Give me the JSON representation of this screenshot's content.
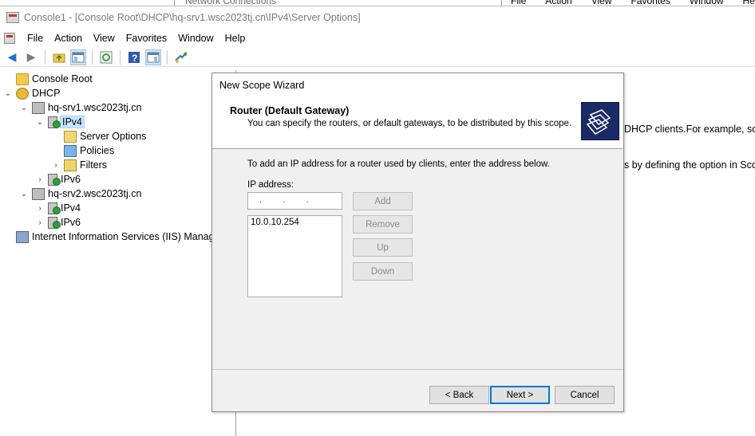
{
  "behind": {
    "title": "Network Connections",
    "menu": [
      "File",
      "Action",
      "View",
      "Favorites",
      "Window",
      "Help"
    ]
  },
  "window": {
    "title": "Console1 - [Console Root\\DHCP\\hq-srv1.wsc2023tj.cn\\IPv4\\Server Options]"
  },
  "menubar": {
    "items": [
      "File",
      "Action",
      "View",
      "Favorites",
      "Window",
      "Help"
    ]
  },
  "toolbar": {
    "icons": [
      "back-icon",
      "forward-icon",
      "up-folder-icon",
      "show-hide-tree-icon",
      "refresh-icon",
      "help-icon",
      "action-pane-icon",
      "dhcp-tool-icon"
    ]
  },
  "tree": {
    "items": [
      {
        "label": "Console Root",
        "icon": "folder-icon"
      },
      {
        "label": "DHCP",
        "icon": "dhcp-icon"
      },
      {
        "label": "hq-srv1.wsc2023tj.cn",
        "icon": "server-icon"
      },
      {
        "label": "IPv4",
        "icon": "ipv4-icon",
        "selected": true
      },
      {
        "label": "Server Options",
        "icon": "server-options-icon"
      },
      {
        "label": "Policies",
        "icon": "policies-icon"
      },
      {
        "label": "Filters",
        "icon": "filters-icon"
      },
      {
        "label": "IPv6",
        "icon": "ipv6-icon"
      },
      {
        "label": "hq-srv2.wsc2023tj.cn",
        "icon": "server-icon"
      },
      {
        "label": "IPv4",
        "icon": "ipv4-icon"
      },
      {
        "label": "IPv6",
        "icon": "ipv6-icon"
      },
      {
        "label": "Internet Information Services (IIS) Manage",
        "icon": "iis-icon"
      }
    ]
  },
  "right_pane": {
    "text1": "DHCP clients.For example, som",
    "text2": "s by defining the option in Scop"
  },
  "wizard": {
    "title": "New Scope Wizard",
    "header_title": "Router (Default Gateway)",
    "header_subtitle": "You can specify the routers, or default gateways, to be distributed by this scope.",
    "instruction": "To add an IP address for a router used by clients, enter the address below.",
    "ip_label": "IP address:",
    "ip_value_dots": "...",
    "routers": [
      "10.0.10.254"
    ],
    "buttons": {
      "add": "Add",
      "remove": "Remove",
      "up": "Up",
      "down": "Down",
      "back": "< Back",
      "next": "Next >",
      "cancel": "Cancel"
    }
  }
}
